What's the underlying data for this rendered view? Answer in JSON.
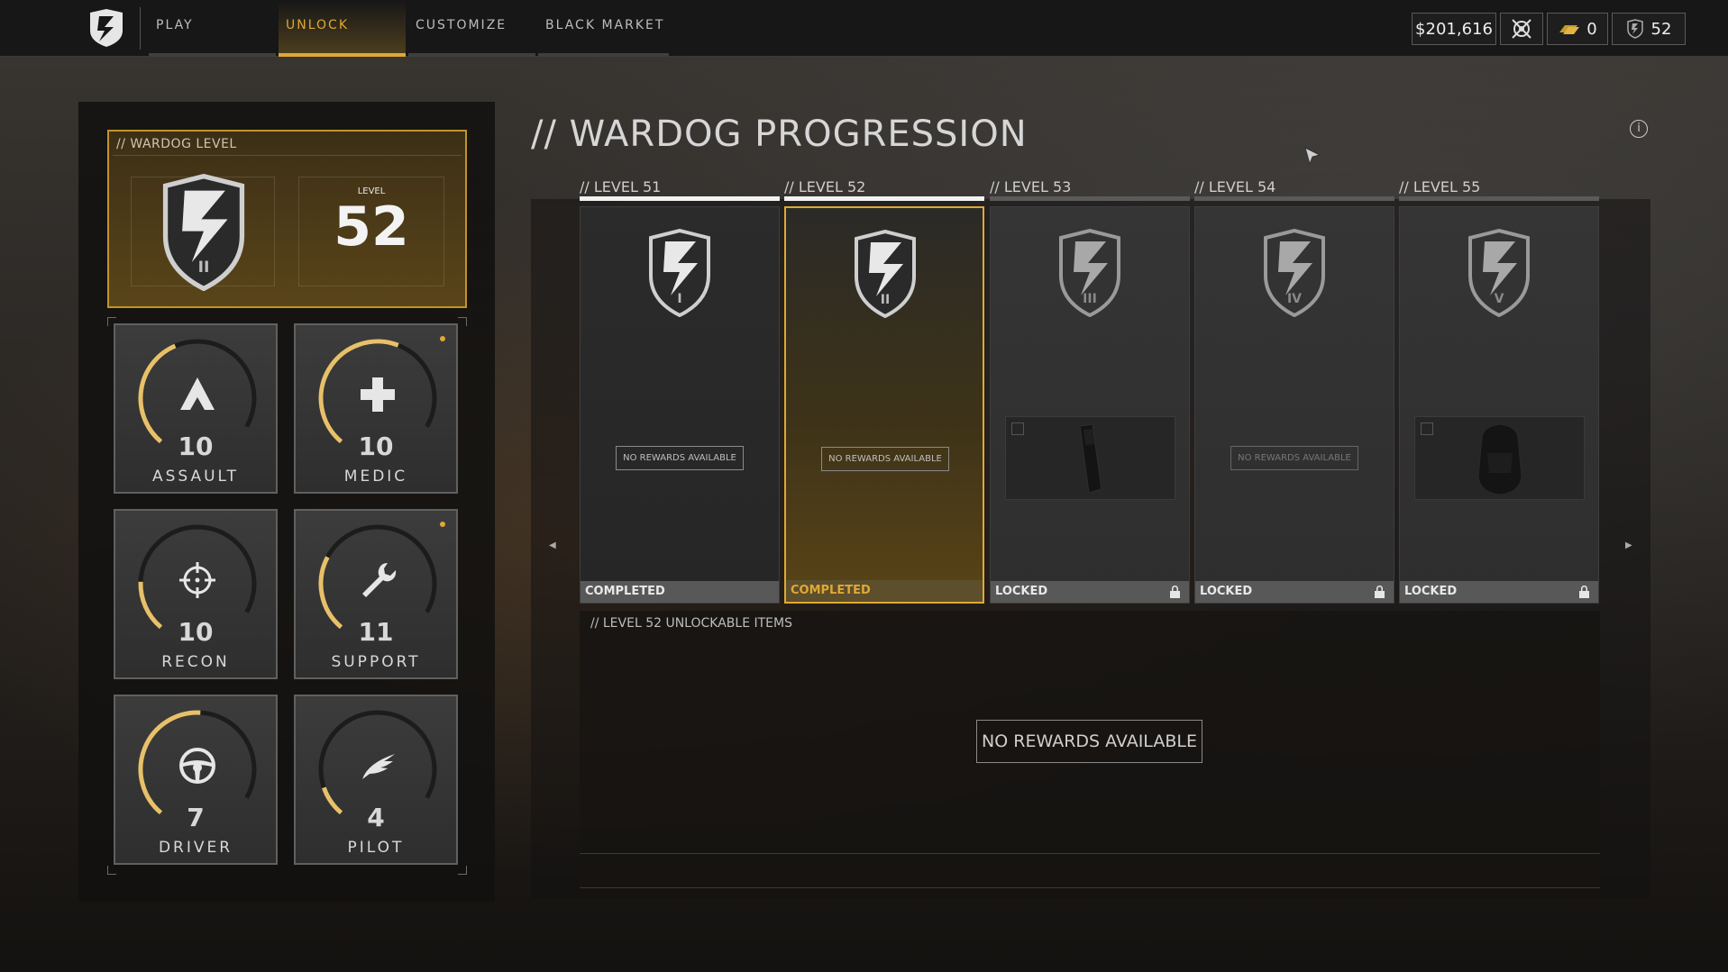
{
  "topbar": {
    "tabs": [
      {
        "label": "PLAY",
        "active": false
      },
      {
        "label": "UNLOCK",
        "active": true
      },
      {
        "label": "CUSTOMIZE",
        "active": false
      },
      {
        "label": "BLACK MARKET",
        "active": false
      }
    ],
    "money": "$201,616",
    "gold": "0",
    "tokens": "52",
    "accent_color": "#e0a832"
  },
  "wardog": {
    "title": "// WARDOG LEVEL",
    "level_label": "LEVEL",
    "level": "52",
    "emblem_rank": "II"
  },
  "classes": [
    {
      "name": "ASSAULT",
      "level": "10",
      "icon": "assault-icon",
      "progress": 0.45,
      "notify": false
    },
    {
      "name": "MEDIC",
      "level": "10",
      "icon": "medic-icon",
      "progress": 0.62,
      "notify": true
    },
    {
      "name": "RECON",
      "level": "10",
      "icon": "crosshair-icon",
      "progress": 0.2,
      "notify": false
    },
    {
      "name": "SUPPORT",
      "level": "11",
      "icon": "wrench-icon",
      "progress": 0.3,
      "notify": true
    },
    {
      "name": "DRIVER",
      "level": "7",
      "icon": "steering-wheel-icon",
      "progress": 0.55,
      "notify": false
    },
    {
      "name": "PILOT",
      "level": "4",
      "icon": "wing-icon",
      "progress": 0.12,
      "notify": false
    }
  ],
  "main": {
    "title": "// WARDOG PROGRESSION",
    "levels": [
      {
        "label": "// LEVEL 51",
        "rank": "I",
        "status": "COMPLETED",
        "reward": "NO REWARDS AVAILABLE",
        "state": "completed"
      },
      {
        "label": "// LEVEL 52",
        "rank": "II",
        "status": "COMPLETED",
        "reward": "NO REWARDS AVAILABLE",
        "state": "current"
      },
      {
        "label": "// LEVEL 53",
        "rank": "III",
        "status": "LOCKED",
        "reward": "",
        "state": "locked",
        "item": "magazine"
      },
      {
        "label": "// LEVEL 54",
        "rank": "IV",
        "status": "LOCKED",
        "reward": "NO REWARDS AVAILABLE",
        "state": "locked"
      },
      {
        "label": "// LEVEL 55",
        "rank": "V",
        "status": "LOCKED",
        "reward": "",
        "state": "locked",
        "item": "backpack"
      }
    ],
    "unlock_title": "// LEVEL 52 UNLOCKABLE ITEMS",
    "unlock_empty": "NO REWARDS AVAILABLE"
  }
}
